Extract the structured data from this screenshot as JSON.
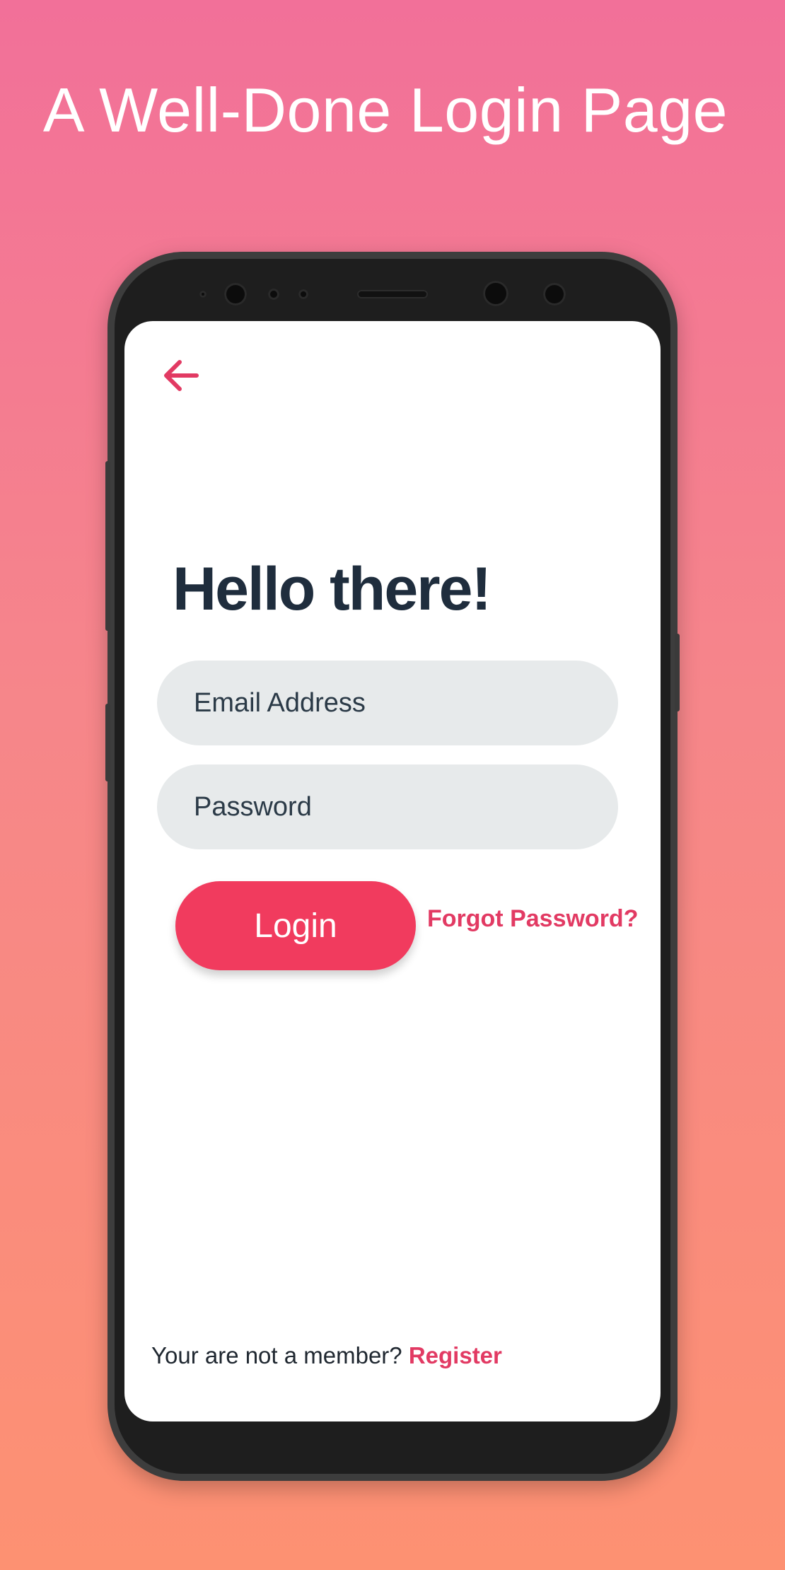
{
  "promo": {
    "title": "A Well-Done Login Page"
  },
  "colors": {
    "accent": "#f13b5e",
    "link": "#e23a63",
    "heading": "#1f2d3d",
    "input_background": "#e7eaeb"
  },
  "screen": {
    "back_icon": "arrow-left-icon",
    "greeting": "Hello there!",
    "email_placeholder": "Email Address",
    "password_placeholder": "Password",
    "login_label": "Login",
    "forgot_label": "Forgot Password?",
    "footer_text": "Your are not a member?",
    "register_label": "Register"
  }
}
